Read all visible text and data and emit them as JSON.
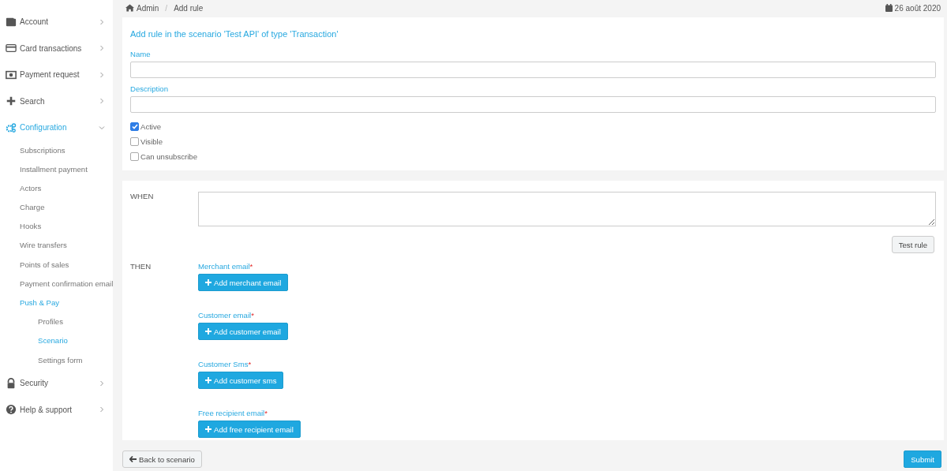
{
  "sidebar": {
    "items": [
      {
        "label": "Account",
        "expanded": false,
        "selected": false
      },
      {
        "label": "Card transactions",
        "expanded": false,
        "selected": false
      },
      {
        "label": "Payment request",
        "expanded": false,
        "selected": false
      },
      {
        "label": "Search",
        "expanded": false,
        "selected": false
      },
      {
        "label": "Configuration",
        "expanded": true,
        "selected": true,
        "children": [
          {
            "label": "Subscriptions",
            "selected": false
          },
          {
            "label": "Installment payment",
            "selected": false
          },
          {
            "label": "Actors",
            "selected": false
          },
          {
            "label": "Charge",
            "selected": false
          },
          {
            "label": "Hooks",
            "selected": false
          },
          {
            "label": "Wire transfers",
            "selected": false
          },
          {
            "label": "Points of sales",
            "selected": false
          },
          {
            "label": "Payment confirmation email",
            "selected": false
          },
          {
            "label": "Push & Pay",
            "selected": true,
            "children": [
              {
                "label": "Profiles",
                "selected": false
              },
              {
                "label": "Scenario",
                "selected": true
              },
              {
                "label": "Settings form",
                "selected": false
              }
            ]
          }
        ]
      },
      {
        "label": "Security",
        "expanded": false,
        "selected": false
      },
      {
        "label": "Help & support",
        "expanded": false,
        "selected": false
      }
    ]
  },
  "breadcrumb": [
    "Admin",
    "Add rule"
  ],
  "breadcrumb_separator": "/",
  "date": "26 août 2020",
  "form": {
    "title": "Add rule in the scenario 'Test API' of type 'Transaction'",
    "fields": [
      {
        "label": "Name"
      },
      {
        "label": "Description"
      }
    ],
    "checkboxes": [
      {
        "label": "Active",
        "checked": true
      },
      {
        "label": "Visible",
        "checked": false
      },
      {
        "label": "Can unsubscribe",
        "checked": false
      }
    ]
  },
  "rule": {
    "when_label": "WHEN",
    "test_button": "Test rule",
    "then_label": "THEN",
    "actions": [
      {
        "label": "Merchant email",
        "required_mark": "*",
        "button": "Add merchant email"
      },
      {
        "label": "Customer email",
        "required_mark": "*",
        "button": "Add customer email"
      },
      {
        "label": "Customer Sms",
        "required_mark": "*",
        "button": "Add customer sms"
      },
      {
        "label": "Free recipient email",
        "required_mark": "*",
        "button": "Add free recipient email"
      }
    ]
  },
  "footer": {
    "back_button": "Back to scenario",
    "submit_button": "Submit"
  }
}
